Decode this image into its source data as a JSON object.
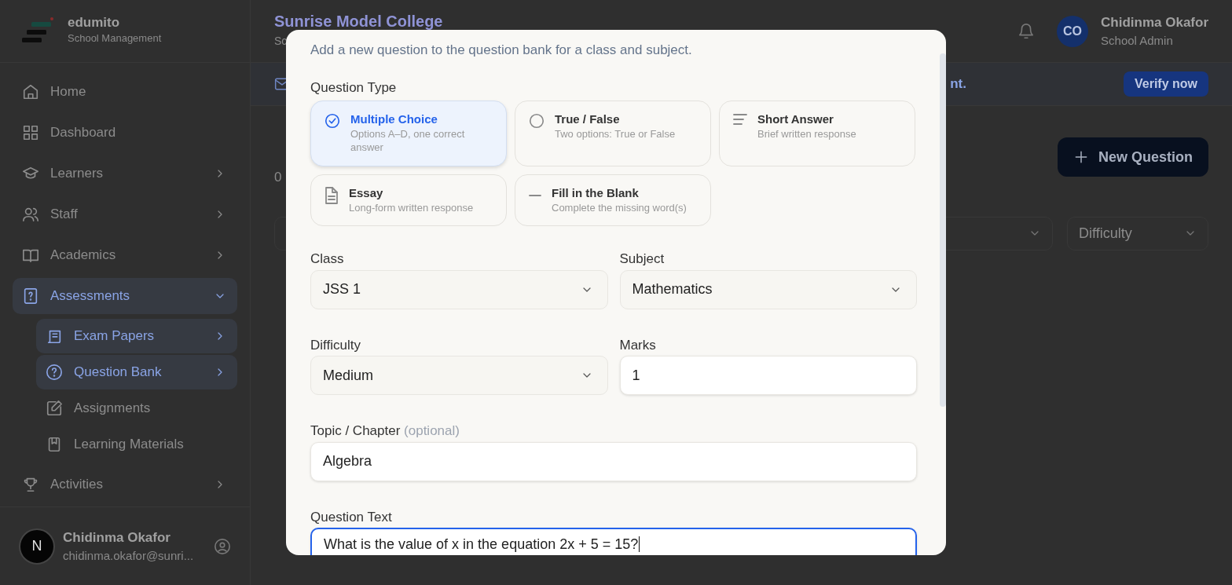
{
  "sidebar": {
    "brand": {
      "name": "edumito",
      "tagline": "School Management"
    },
    "items": [
      {
        "label": "Home",
        "kind": "link",
        "selected": false
      },
      {
        "label": "Dashboard",
        "kind": "link",
        "selected": false
      },
      {
        "label": "Learners",
        "kind": "group",
        "expanded": false,
        "selected": false
      },
      {
        "label": "Staff",
        "kind": "group",
        "expanded": false,
        "selected": false
      },
      {
        "label": "Academics",
        "kind": "group",
        "expanded": false,
        "selected": false
      },
      {
        "label": "Assessments",
        "kind": "group",
        "expanded": true,
        "selected": true,
        "children": [
          {
            "label": "Exam Papers",
            "kind": "group",
            "expanded": false,
            "selected": true
          },
          {
            "label": "Question Bank",
            "kind": "group",
            "expanded": false,
            "selected": true
          },
          {
            "label": "Assignments",
            "kind": "link",
            "selected": false
          },
          {
            "label": "Learning Materials",
            "kind": "link",
            "selected": false
          }
        ]
      },
      {
        "label": "Activities",
        "kind": "group",
        "expanded": false,
        "selected": false
      }
    ],
    "user": {
      "initial": "N",
      "name": "Chidinma Okafor",
      "email": "chidinma.okafor@sunri..."
    }
  },
  "header": {
    "title": "Sunrise Model College",
    "subtitle": "Sc",
    "user": {
      "initials": "CO",
      "name": "Chidinma Okafor",
      "role": "School Admin"
    }
  },
  "banner": {
    "text": "nt.",
    "button": "Verify now"
  },
  "page": {
    "count": "0",
    "new_button": "New Question"
  },
  "filters": [
    {
      "label": "Difficulty"
    }
  ],
  "modal": {
    "subtitle": "Add a new question to the question bank for a class and subject.",
    "type_label": "Question Type",
    "types": [
      {
        "title": "Multiple Choice",
        "description": "Options A–D, one correct answer",
        "selected": true
      },
      {
        "title": "True / False",
        "description": "Two options: True or False",
        "selected": false
      },
      {
        "title": "Short Answer",
        "description": "Brief written response",
        "selected": false
      },
      {
        "title": "Essay",
        "description": "Long-form written response",
        "selected": false
      },
      {
        "title": "Fill in the Blank",
        "description": "Complete the missing word(s)",
        "selected": false
      }
    ],
    "fields": [
      {
        "label": "Class",
        "kind": "select",
        "value": "JSS 1"
      },
      {
        "label": "Subject",
        "kind": "select",
        "value": "Mathematics"
      },
      {
        "label": "Difficulty",
        "kind": "select",
        "value": "Medium"
      },
      {
        "label": "Marks",
        "kind": "input",
        "value": "1"
      },
      {
        "label": "Topic / Chapter",
        "hint": "(optional)",
        "kind": "input",
        "value": "Algebra",
        "wide": true
      },
      {
        "label": "Question Text",
        "kind": "textarea",
        "value": "What is the value of x in the equation 2x + 5 = 15?",
        "wide": true,
        "focused": true
      }
    ]
  }
}
